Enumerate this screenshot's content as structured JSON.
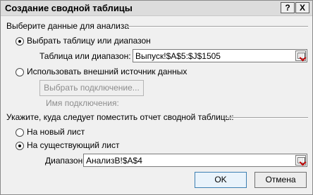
{
  "window": {
    "title": "Создание сводной таблицы",
    "help_label": "?",
    "close_label": "X"
  },
  "data_section": {
    "title": "Выберите данные для анализа",
    "option_table": {
      "label": "Выбрать таблицу или диапазон",
      "checked": true
    },
    "range_label": "Таблица или диапазон:",
    "range_value": "Выпуск!$A$5:$J$1505",
    "option_external": {
      "label": "Использовать внешний источник данных",
      "checked": false
    },
    "choose_connection_label": "Выбрать подключение...",
    "connection_name_label": "Имя подключения:"
  },
  "location_section": {
    "title": "Укажите, куда следует поместить отчет сводной таблицы:",
    "option_new_sheet": {
      "label": "На новый лист",
      "checked": false
    },
    "option_existing_sheet": {
      "label": "На существующий лист",
      "checked": true
    },
    "location_label": "Диапазон:",
    "location_value": "АнализВ!$A$4"
  },
  "buttons": {
    "ok": "OK",
    "cancel": "Отмена"
  },
  "icons": {
    "range_picker": "collapse-dialog-icon"
  }
}
